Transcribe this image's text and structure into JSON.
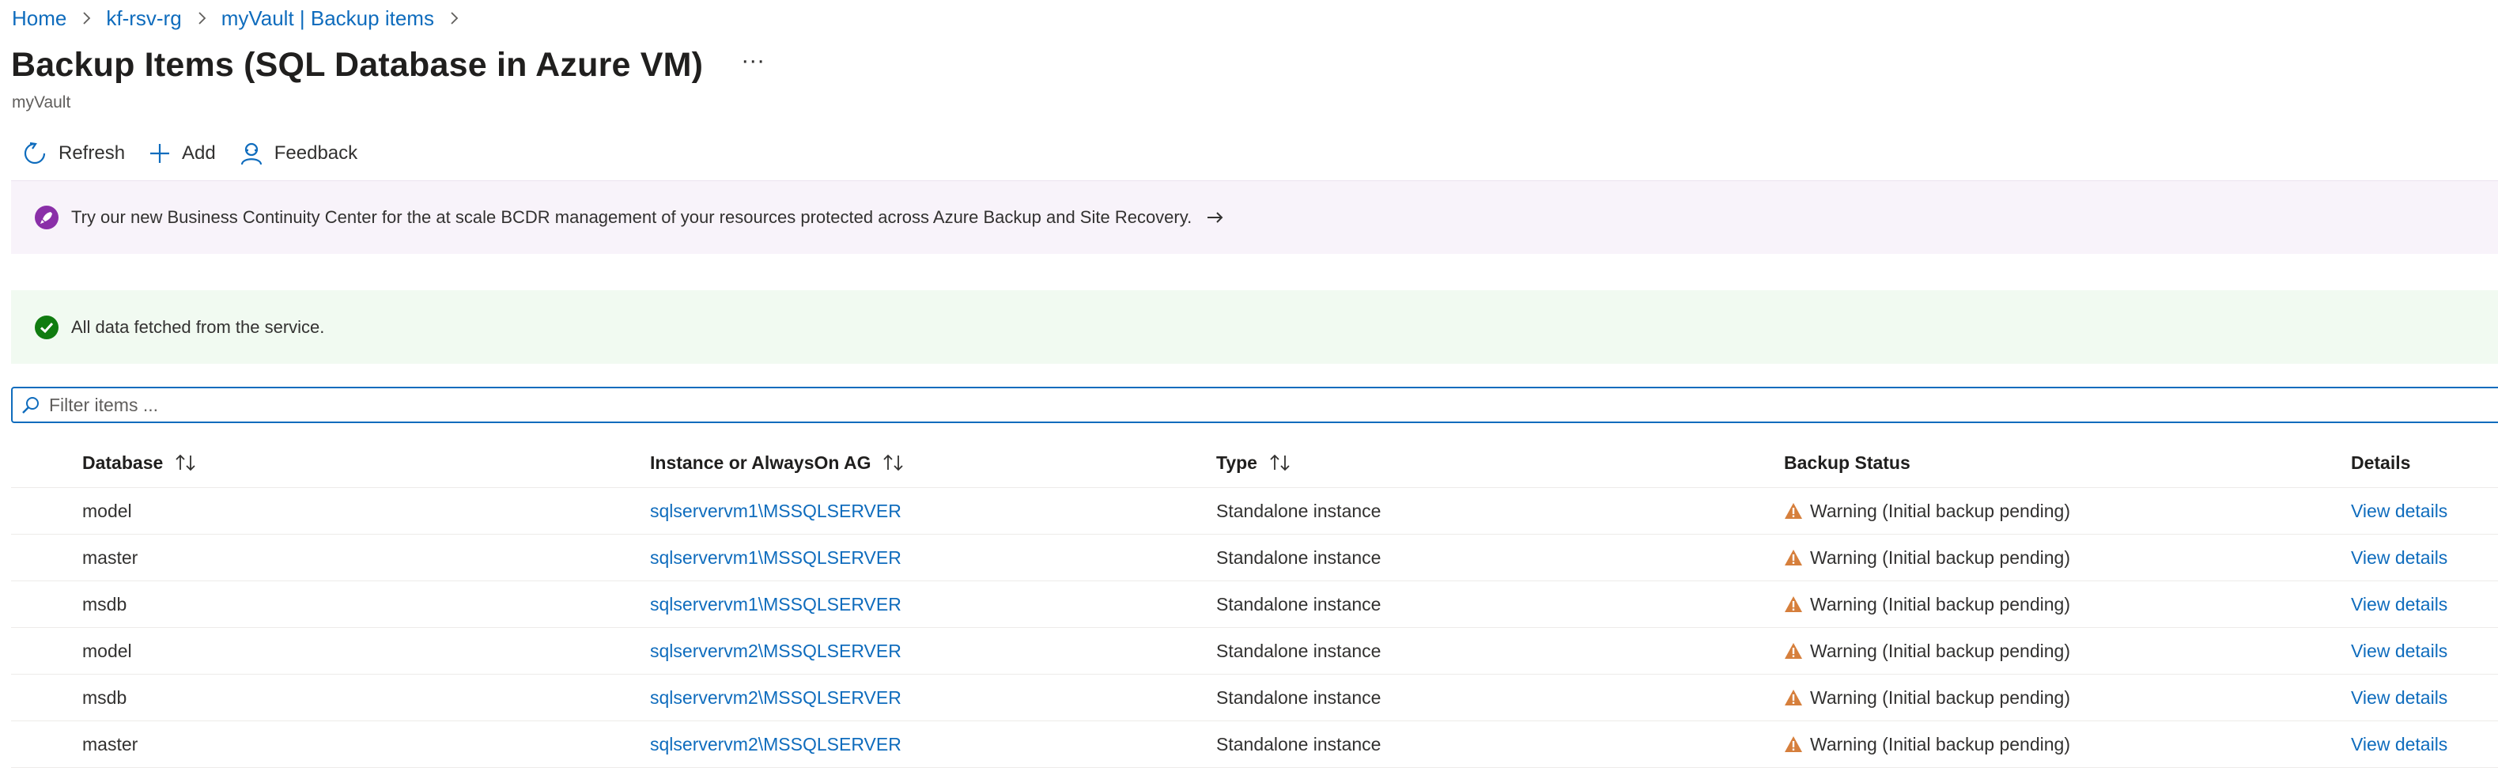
{
  "breadcrumb": [
    {
      "label": "Home"
    },
    {
      "label": "kf-rsv-rg"
    },
    {
      "label": "myVault | Backup items"
    }
  ],
  "header": {
    "title": "Backup Items (SQL Database in Azure VM)",
    "more": "···",
    "subtitle": "myVault"
  },
  "toolbar": {
    "refresh_label": "Refresh",
    "add_label": "Add",
    "feedback_label": "Feedback"
  },
  "banners": {
    "promo_text": "Try our new Business Continuity Center for the at scale BCDR management of your resources protected across Azure Backup and Site Recovery.",
    "status_text": "All data fetched from the service."
  },
  "search": {
    "placeholder": "Filter items ...",
    "value": ""
  },
  "table": {
    "columns": [
      "Database",
      "Instance or AlwaysOn AG",
      "Type",
      "Backup Status",
      "Details"
    ],
    "rows": [
      {
        "database": "model",
        "instance": "sqlservervm1\\MSSQLSERVER",
        "type": "Standalone instance",
        "status": "Warning (Initial backup pending)",
        "details": "View details"
      },
      {
        "database": "master",
        "instance": "sqlservervm1\\MSSQLSERVER",
        "type": "Standalone instance",
        "status": "Warning (Initial backup pending)",
        "details": "View details"
      },
      {
        "database": "msdb",
        "instance": "sqlservervm1\\MSSQLSERVER",
        "type": "Standalone instance",
        "status": "Warning (Initial backup pending)",
        "details": "View details"
      },
      {
        "database": "model",
        "instance": "sqlservervm2\\MSSQLSERVER",
        "type": "Standalone instance",
        "status": "Warning (Initial backup pending)",
        "details": "View details"
      },
      {
        "database": "msdb",
        "instance": "sqlservervm2\\MSSQLSERVER",
        "type": "Standalone instance",
        "status": "Warning (Initial backup pending)",
        "details": "View details"
      },
      {
        "database": "master",
        "instance": "sqlservervm2\\MSSQLSERVER",
        "type": "Standalone instance",
        "status": "Warning (Initial backup pending)",
        "details": "View details"
      }
    ]
  },
  "colors": {
    "accent": "#0f6cbd",
    "warning": "#d67f3c",
    "success": "#107c10",
    "promo_icon": "#8a2fa8",
    "promo_bg": "#f8f3fa",
    "status_bg": "#f1faf1"
  },
  "icons": {
    "refresh": "refresh-icon",
    "add": "add-icon",
    "feedback": "feedback-icon",
    "promo": "rocket-icon",
    "status": "success-check-icon",
    "search": "search-icon",
    "sort": "sort-icon",
    "warning": "warning-icon",
    "chevron": "chevron-right-icon",
    "arrow": "arrow-right-icon"
  }
}
